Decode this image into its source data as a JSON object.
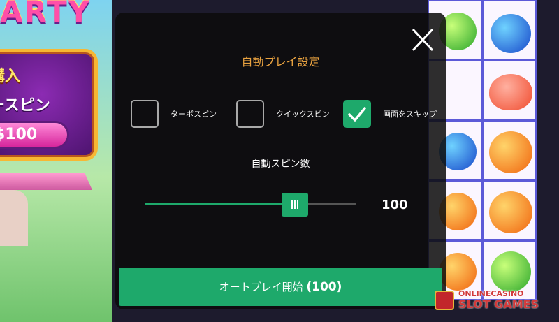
{
  "background": {
    "logo_text": "ARTY",
    "buy_feature": {
      "title": "購入",
      "subtitle": "ースピン",
      "price": "$100"
    }
  },
  "autoplay_dialog": {
    "title": "自動プレイ設定",
    "close_icon": "close-icon",
    "options": [
      {
        "label": "ターボスピン",
        "checked": false
      },
      {
        "label": "クイックスピン",
        "checked": false
      },
      {
        "label": "画面をスキップ",
        "checked": true
      }
    ],
    "spin_count_label": "自動スピン数",
    "spin_count_value": "100",
    "slider_fraction": 0.71,
    "start_button": {
      "label": "オートプレイ開始",
      "count": "(100)"
    }
  },
  "colors": {
    "accent_green": "#1ea96b",
    "title_orange": "#e9a240"
  },
  "watermark": {
    "line1": "ONLINECASINO",
    "line2": "SLOT GAMES"
  }
}
